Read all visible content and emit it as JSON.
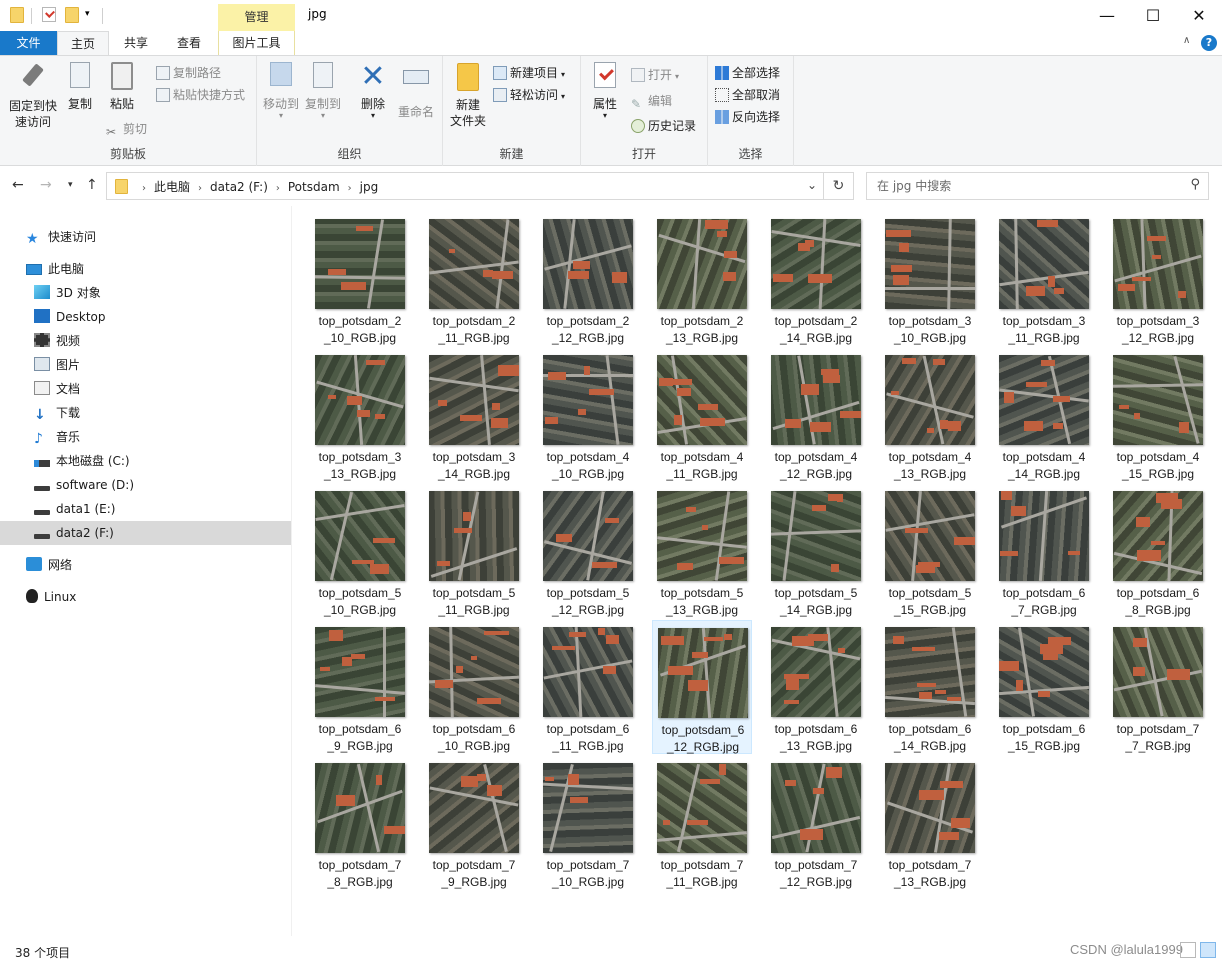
{
  "titlebar": {
    "contextual_tab": "管理",
    "window_title": "jpg",
    "minimize": "—",
    "maximize": "☐",
    "close": "✕"
  },
  "ribbon_tabs": {
    "file": "文件",
    "home": "主页",
    "share": "共享",
    "view": "查看",
    "picture_tools": "图片工具"
  },
  "ribbon": {
    "clipboard": {
      "label": "剪贴板",
      "pin": [
        "固定到快",
        "速访问"
      ],
      "copy": "复制",
      "paste": "粘贴",
      "copy_path": "复制路径",
      "paste_shortcut": "粘贴快捷方式",
      "cut": "剪切"
    },
    "organize": {
      "label": "组织",
      "move_to": "移动到",
      "copy_to": "复制到",
      "delete": "删除",
      "rename": "重命名"
    },
    "new": {
      "label": "新建",
      "new_folder": [
        "新建",
        "文件夹"
      ],
      "new_item": "新建项目",
      "easy_access": "轻松访问"
    },
    "open": {
      "label": "打开",
      "properties": "属性",
      "open": "打开",
      "edit": "编辑",
      "history": "历史记录"
    },
    "select": {
      "label": "选择",
      "select_all": "全部选择",
      "select_none": "全部取消",
      "invert": "反向选择"
    }
  },
  "address": {
    "crumbs": [
      "此电脑",
      "data2 (F:)",
      "Potsdam",
      "jpg"
    ],
    "search_placeholder": "在 jpg 中搜索"
  },
  "nav_pane": [
    {
      "label": "快速访问",
      "icon": "star-icon"
    },
    {
      "label": "此电脑",
      "icon": "computer-icon"
    },
    {
      "label": "3D 对象",
      "icon": "3d-objects-icon"
    },
    {
      "label": "Desktop",
      "icon": "desktop-icon"
    },
    {
      "label": "视频",
      "icon": "video-icon"
    },
    {
      "label": "图片",
      "icon": "pictures-icon"
    },
    {
      "label": "文档",
      "icon": "documents-icon"
    },
    {
      "label": "下载",
      "icon": "download-icon"
    },
    {
      "label": "音乐",
      "icon": "music-icon"
    },
    {
      "label": "本地磁盘 (C:)",
      "icon": "system-drive-icon"
    },
    {
      "label": "software (D:)",
      "icon": "drive-icon"
    },
    {
      "label": "data1 (E:)",
      "icon": "drive-icon"
    },
    {
      "label": "data2 (F:)",
      "icon": "drive-icon",
      "selected": true
    },
    {
      "label": "网络",
      "icon": "network-icon"
    },
    {
      "label": "Linux",
      "icon": "linux-icon"
    }
  ],
  "files": [
    [
      "top_potsdam_2",
      "_10_RGB.jpg"
    ],
    [
      "top_potsdam_2",
      "_11_RGB.jpg"
    ],
    [
      "top_potsdam_2",
      "_12_RGB.jpg"
    ],
    [
      "top_potsdam_2",
      "_13_RGB.jpg"
    ],
    [
      "top_potsdam_2",
      "_14_RGB.jpg"
    ],
    [
      "top_potsdam_3",
      "_10_RGB.jpg"
    ],
    [
      "top_potsdam_3",
      "_11_RGB.jpg"
    ],
    [
      "top_potsdam_3",
      "_12_RGB.jpg"
    ],
    [
      "top_potsdam_3",
      "_13_RGB.jpg"
    ],
    [
      "top_potsdam_3",
      "_14_RGB.jpg"
    ],
    [
      "top_potsdam_4",
      "_10_RGB.jpg"
    ],
    [
      "top_potsdam_4",
      "_11_RGB.jpg"
    ],
    [
      "top_potsdam_4",
      "_12_RGB.jpg"
    ],
    [
      "top_potsdam_4",
      "_13_RGB.jpg"
    ],
    [
      "top_potsdam_4",
      "_14_RGB.jpg"
    ],
    [
      "top_potsdam_4",
      "_15_RGB.jpg"
    ],
    [
      "top_potsdam_5",
      "_10_RGB.jpg"
    ],
    [
      "top_potsdam_5",
      "_11_RGB.jpg"
    ],
    [
      "top_potsdam_5",
      "_12_RGB.jpg"
    ],
    [
      "top_potsdam_5",
      "_13_RGB.jpg"
    ],
    [
      "top_potsdam_5",
      "_14_RGB.jpg"
    ],
    [
      "top_potsdam_5",
      "_15_RGB.jpg"
    ],
    [
      "top_potsdam_6",
      "_7_RGB.jpg"
    ],
    [
      "top_potsdam_6",
      "_8_RGB.jpg"
    ],
    [
      "top_potsdam_6",
      "_9_RGB.jpg"
    ],
    [
      "top_potsdam_6",
      "_10_RGB.jpg"
    ],
    [
      "top_potsdam_6",
      "_11_RGB.jpg"
    ],
    [
      "top_potsdam_6",
      "_12_RGB.jpg"
    ],
    [
      "top_potsdam_6",
      "_13_RGB.jpg"
    ],
    [
      "top_potsdam_6",
      "_14_RGB.jpg"
    ],
    [
      "top_potsdam_6",
      "_15_RGB.jpg"
    ],
    [
      "top_potsdam_7",
      "_7_RGB.jpg"
    ],
    [
      "top_potsdam_7",
      "_8_RGB.jpg"
    ],
    [
      "top_potsdam_7",
      "_9_RGB.jpg"
    ],
    [
      "top_potsdam_7",
      "_10_RGB.jpg"
    ],
    [
      "top_potsdam_7",
      "_11_RGB.jpg"
    ],
    [
      "top_potsdam_7",
      "_12_RGB.jpg"
    ],
    [
      "top_potsdam_7",
      "_13_RGB.jpg"
    ]
  ],
  "selected_file_index": 27,
  "status": {
    "item_count": "38 个项目",
    "watermark": "CSDN @lalula1999"
  },
  "colors": {
    "accent": "#1979ca",
    "context_tab": "#fbf2a7",
    "selection": "#e5f3ff",
    "nav_selected": "#d9d9d9"
  }
}
